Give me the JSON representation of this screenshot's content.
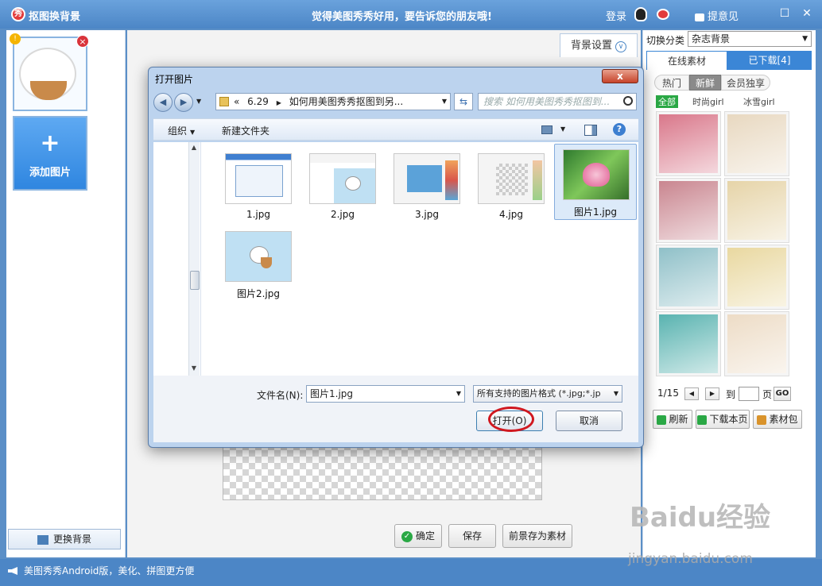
{
  "titlebar": {
    "app_title": "抠图换背景",
    "slogan": "觉得美图秀秀好用，要告诉您的朋友哦!",
    "login": "登录",
    "feedback": "提意见",
    "app_icon_text": "秀"
  },
  "left": {
    "add_image": "添加图片",
    "change_bg": "更换背景",
    "badge": "!"
  },
  "center": {
    "bg_settings": "背景设置",
    "confirm": "确定",
    "save": "保存",
    "save_as_material": "前景存为素材"
  },
  "right": {
    "switch_label": "切换分类",
    "category": "杂志背景",
    "tabs": [
      "在线素材",
      "已下载[4]"
    ],
    "filters": [
      "热门",
      "新鲜",
      "会员独享"
    ],
    "subfilters": [
      "全部",
      "时尚girl",
      "冰雪girl"
    ],
    "pager": {
      "page": "1/15",
      "to": "到",
      "unit": "页",
      "go": "GO"
    },
    "buttons": [
      "刷新",
      "下载本页",
      "素材包"
    ],
    "tile_colors": [
      "#d9778a",
      "#e8d8c0",
      "#c9858f",
      "#e6d4a8",
      "#8fc0c8",
      "#e9d8a0",
      "#59b3b0",
      "#eddcc6"
    ]
  },
  "dialog": {
    "title": "打开图片",
    "close": "x",
    "address": {
      "prefix": "«",
      "folder": "6.29",
      "path": "如何用美图秀秀抠图到另..."
    },
    "search_placeholder": "搜索 如何用美图秀秀抠图到...",
    "toolbar": {
      "organize": "组织",
      "new_folder": "新建文件夹"
    },
    "files": [
      {
        "name": "1.jpg",
        "selected": false
      },
      {
        "name": "2.jpg",
        "selected": false
      },
      {
        "name": "3.jpg",
        "selected": false
      },
      {
        "name": "4.jpg",
        "selected": false
      },
      {
        "name": "图片1.jpg",
        "selected": true
      },
      {
        "name": "图片2.jpg",
        "selected": false
      }
    ],
    "filename_label": "文件名(N):",
    "filename_value": "图片1.jpg",
    "filetype": "所有支持的图片格式 (*.jpg;*.jp",
    "open": "打开(O)",
    "cancel": "取消"
  },
  "statusbar": {
    "message": "美图秀秀Android版，美化、拼图更方便"
  },
  "watermark": {
    "brand": "Baidu经验",
    "url": "jingyan.baidu.com"
  }
}
